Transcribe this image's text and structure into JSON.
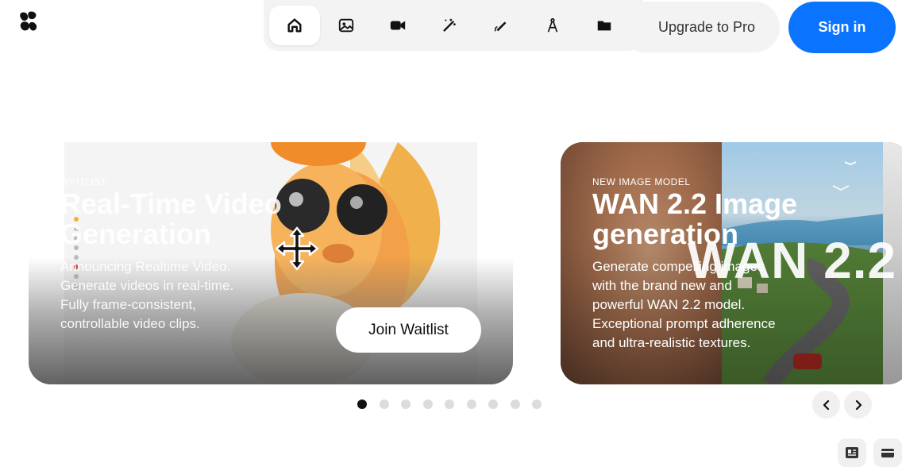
{
  "header": {
    "logo_icon": "krea-logo-icon",
    "tools": [
      {
        "name": "home",
        "icon": "home-icon",
        "active": true
      },
      {
        "name": "image",
        "icon": "image-icon",
        "active": false
      },
      {
        "name": "video",
        "icon": "video-camera-icon",
        "active": false
      },
      {
        "name": "enhance",
        "icon": "magic-wand-icon",
        "active": false
      },
      {
        "name": "edit",
        "icon": "pen-icon",
        "active": false
      },
      {
        "name": "train",
        "icon": "compass-icon",
        "active": false
      },
      {
        "name": "assets",
        "icon": "folder-icon",
        "active": false
      }
    ],
    "upgrade_label": "Upgrade to Pro",
    "signin_label": "Sign in",
    "accent_color": "#0a74ff"
  },
  "carousel": {
    "cards": [
      {
        "eyebrow": "WAITLIST",
        "title": "Real-Time Video Generation",
        "description": "Announcing Realtime Video. Generate videos in real-time. Fully frame-consistent, controllable video clips.",
        "button_label": "Join Waitlist"
      },
      {
        "eyebrow": "NEW IMAGE MODEL",
        "title": "WAN 2.2 Image generation",
        "description": "Generate compelling images with the brand new and powerful WAN 2.2 model. Exceptional prompt adherence and ultra-realistic textures.",
        "overlay_text": "WAN 2.2"
      }
    ],
    "page_count": 9,
    "active_page": 1,
    "prev_icon": "chevron-left-icon",
    "next_icon": "chevron-right-icon"
  },
  "corner": {
    "left_icon": "news-icon",
    "right_icon": "credit-card-icon"
  }
}
